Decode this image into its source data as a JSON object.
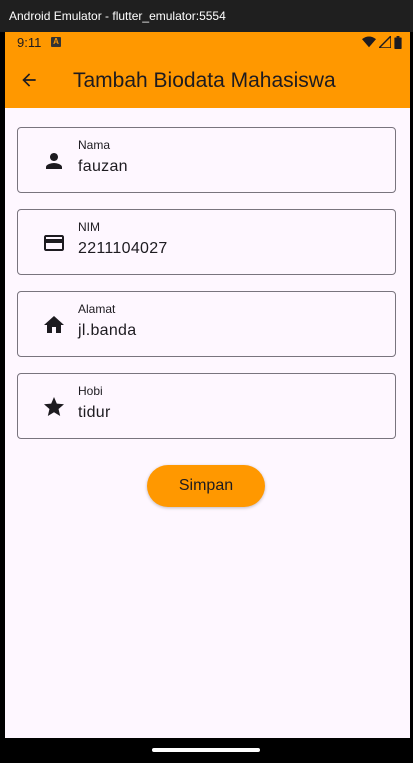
{
  "window": {
    "title": "Android Emulator - flutter_emulator:5554"
  },
  "status_bar": {
    "time": "9:11",
    "notification_icon_letter": "A",
    "icons": [
      "wifi-icon",
      "signal-icon",
      "battery-icon"
    ]
  },
  "app_bar": {
    "title": "Tambah Biodata Mahasiswa",
    "back_icon": "arrow-back-icon"
  },
  "form": {
    "fields": [
      {
        "label": "Nama",
        "value": "fauzan",
        "icon": "person-icon"
      },
      {
        "label": "NIM",
        "value": "2211104027",
        "icon": "credit-card-icon"
      },
      {
        "label": "Alamat",
        "value": "jl.banda",
        "icon": "home-icon"
      },
      {
        "label": "Hobi",
        "value": "tidur",
        "icon": "star-icon"
      }
    ],
    "submit_label": "Simpan"
  },
  "colors": {
    "accent": "#ff9800",
    "background": "#fef7ff",
    "outline": "#79747e",
    "text": "#1d1b20"
  }
}
